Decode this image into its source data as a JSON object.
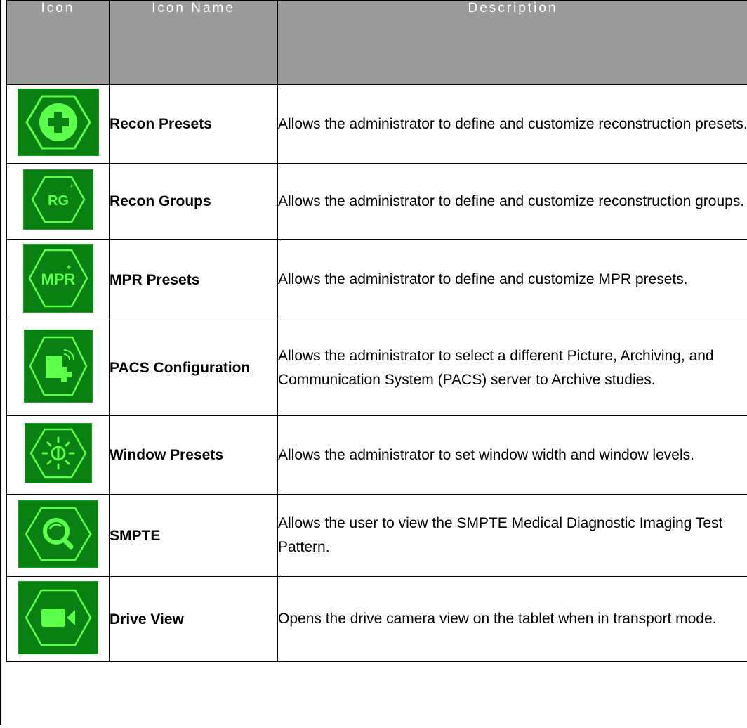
{
  "table": {
    "headers": {
      "icon": "Icon",
      "name": "Icon Name",
      "description": "Description"
    },
    "rows": [
      {
        "icon": "recon-presets-plus-icon",
        "name": "Recon Presets",
        "description": "Allows the administrator to define and customize reconstruction presets."
      },
      {
        "icon": "recon-groups-rg-icon",
        "icon_text": "RG",
        "name": "Recon Groups",
        "description": "Allows the administrator to define and customize reconstruction groups."
      },
      {
        "icon": "mpr-presets-icon",
        "icon_text": "MPR",
        "name": "MPR Presets",
        "description": "Allows the administrator to define and customize MPR presets."
      },
      {
        "icon": "pacs-configuration-icon",
        "name": "PACS Configuration",
        "description": "Allows the administrator to select a different Picture, Archiving, and Communication System (PACS) server to Archive studies."
      },
      {
        "icon": "window-presets-sun-icon",
        "name": "Window Presets",
        "description": "Allows the administrator to set window width and window levels."
      },
      {
        "icon": "smpte-magnifier-icon",
        "name": "SMPTE",
        "description": "Allows the user to view the SMPTE Medical Diagnostic Imaging Test Pattern."
      },
      {
        "icon": "drive-view-camera-icon",
        "name": "Drive View",
        "description": "Opens the drive camera view on the tablet when in transport mode."
      }
    ]
  },
  "colors": {
    "header_bg": "#9b9b9b",
    "header_text": "#ffffff",
    "icon_bg": "#0a7f12",
    "icon_fg": "#5cff4a"
  }
}
